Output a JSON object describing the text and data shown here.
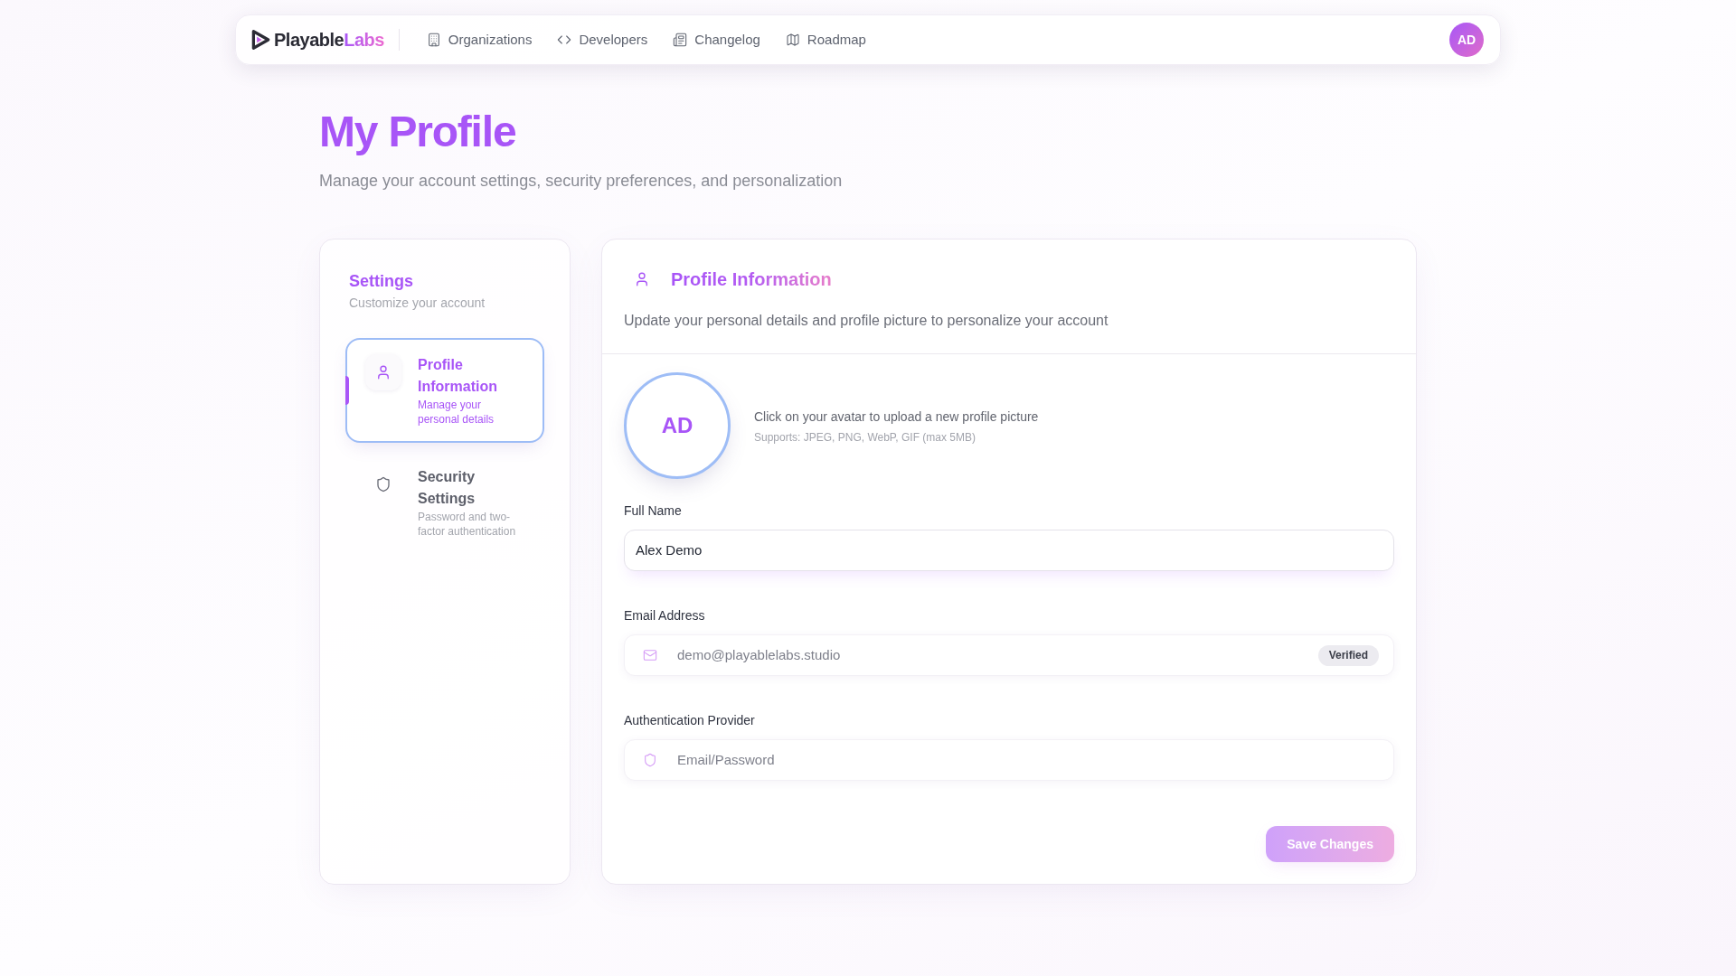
{
  "nav": {
    "logo": {
      "name": "Playable",
      "accent": "Labs"
    },
    "links": [
      {
        "label": "Organizations"
      },
      {
        "label": "Developers"
      },
      {
        "label": "Changelog"
      },
      {
        "label": "Roadmap"
      }
    ],
    "avatar": "AD"
  },
  "page": {
    "title": "My Profile",
    "subtitle": "Manage your account settings, security preferences, and personalization"
  },
  "sidebar": {
    "title": "Settings",
    "subtitle": "Customize your account",
    "items": [
      {
        "title": "Profile Information",
        "description": "Manage your personal details",
        "selected": true
      },
      {
        "title": "Security Settings",
        "description": "Password and two-factor authentication",
        "selected": false
      }
    ]
  },
  "panel": {
    "title": "Profile Information",
    "description": "Update your personal details and profile picture to personalize your account",
    "avatar": {
      "initials": "AD",
      "hint": "Click on your avatar to upload a new profile picture",
      "formats": "Supports: JPEG, PNG, WebP, GIF (max 5MB)"
    },
    "fields": [
      {
        "kind": "text",
        "label": "Full Name",
        "value": "Alex Demo",
        "disabled": false
      },
      {
        "kind": "email",
        "label": "Email Address",
        "value": "demo@playablelabs.studio",
        "disabled": true,
        "badge": "Verified"
      },
      {
        "kind": "provider",
        "label": "Authentication Provider",
        "value": "Email/Password",
        "disabled": true
      }
    ],
    "save_button": {
      "label": "Save Changes",
      "disabled": true
    }
  }
}
